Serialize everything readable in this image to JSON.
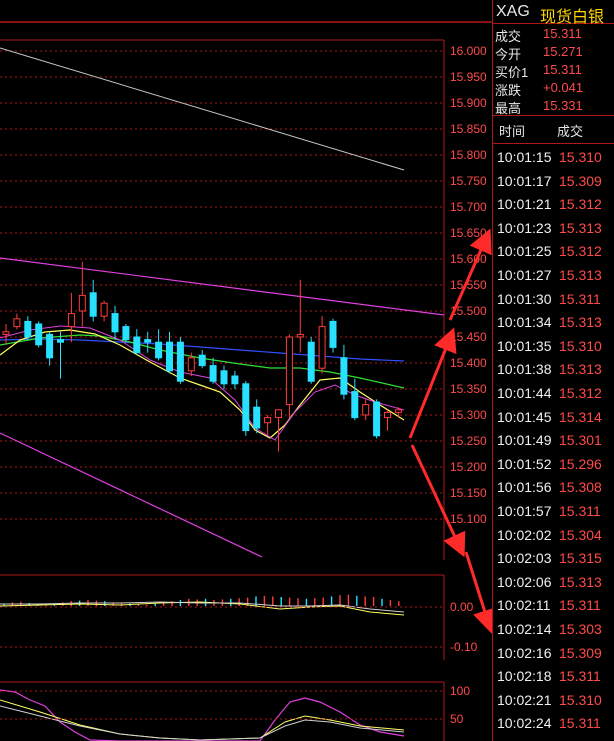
{
  "symbol": "XAG",
  "symbol_name": "现货白银",
  "quote": [
    {
      "label": "成交",
      "value": "15.311"
    },
    {
      "label": "今开",
      "value": "15.271"
    },
    {
      "label": "买价1",
      "value": "15.311"
    },
    {
      "label": "涨跌",
      "value": "+0.041"
    },
    {
      "label": "最高",
      "value": "15.331"
    }
  ],
  "ticks_header": {
    "time": "时间",
    "price": "成交"
  },
  "ticks": [
    {
      "time": "10:01:15",
      "price": "15.310"
    },
    {
      "time": "10:01:17",
      "price": "15.309"
    },
    {
      "time": "10:01:21",
      "price": "15.312"
    },
    {
      "time": "10:01:23",
      "price": "15.313"
    },
    {
      "time": "10:01:25",
      "price": "15.312"
    },
    {
      "time": "10:01:27",
      "price": "15.313"
    },
    {
      "time": "10:01:30",
      "price": "15.311"
    },
    {
      "time": "10:01:34",
      "price": "15.313"
    },
    {
      "time": "10:01:35",
      "price": "15.310"
    },
    {
      "time": "10:01:38",
      "price": "15.313"
    },
    {
      "time": "10:01:44",
      "price": "15.312"
    },
    {
      "time": "10:01:45",
      "price": "15.314"
    },
    {
      "time": "10:01:49",
      "price": "15.301"
    },
    {
      "time": "10:01:52",
      "price": "15.296"
    },
    {
      "time": "10:01:56",
      "price": "15.308"
    },
    {
      "time": "10:01:57",
      "price": "15.311"
    },
    {
      "time": "10:02:02",
      "price": "15.304"
    },
    {
      "time": "10:02:03",
      "price": "15.315"
    },
    {
      "time": "10:02:06",
      "price": "15.313"
    },
    {
      "time": "10:02:11",
      "price": "15.311"
    },
    {
      "time": "10:02:14",
      "price": "15.303"
    },
    {
      "time": "10:02:16",
      "price": "15.309"
    },
    {
      "time": "10:02:18",
      "price": "15.311"
    },
    {
      "time": "10:02:21",
      "price": "15.310"
    },
    {
      "time": "10:02:24",
      "price": "15.311"
    }
  ],
  "colors": {
    "grid": "#b01818",
    "up": "#ff3c3c",
    "down": "#28e0ff",
    "arrow": "#ff2a2a",
    "ma_purple": "#e040e0",
    "ma_yellow": "#ffff60",
    "ma_green": "#30e030",
    "ma_blue": "#3050ff",
    "ma_white": "#d0d0d0"
  },
  "chart_data": [
    {
      "type": "candlestick",
      "y_ticks": [
        "16.000",
        "15.950",
        "15.900",
        "15.850",
        "15.800",
        "15.750",
        "15.700",
        "15.650",
        "15.600",
        "15.550",
        "15.500",
        "15.450",
        "15.400",
        "15.350",
        "15.300",
        "15.250",
        "15.200",
        "15.150",
        "15.100"
      ],
      "ylim": [
        15.09,
        16.01
      ],
      "candles": [
        {
          "o": 15.455,
          "h": 15.475,
          "l": 15.435,
          "c": 15.46
        },
        {
          "o": 15.47,
          "h": 15.495,
          "l": 15.465,
          "c": 15.485
        },
        {
          "o": 15.48,
          "h": 15.49,
          "l": 15.445,
          "c": 15.45
        },
        {
          "o": 15.475,
          "h": 15.48,
          "l": 15.43,
          "c": 15.435
        },
        {
          "o": 15.455,
          "h": 15.46,
          "l": 15.395,
          "c": 15.41
        },
        {
          "o": 15.445,
          "h": 15.46,
          "l": 15.37,
          "c": 15.44
        },
        {
          "o": 15.47,
          "h": 15.535,
          "l": 15.44,
          "c": 15.495
        },
        {
          "o": 15.5,
          "h": 15.595,
          "l": 15.47,
          "c": 15.53
        },
        {
          "o": 15.535,
          "h": 15.56,
          "l": 15.48,
          "c": 15.49
        },
        {
          "o": 15.49,
          "h": 15.52,
          "l": 15.48,
          "c": 15.515
        },
        {
          "o": 15.495,
          "h": 15.51,
          "l": 15.445,
          "c": 15.46
        },
        {
          "o": 15.47,
          "h": 15.475,
          "l": 15.44,
          "c": 15.445
        },
        {
          "o": 15.45,
          "h": 15.465,
          "l": 15.415,
          "c": 15.42
        },
        {
          "o": 15.445,
          "h": 15.46,
          "l": 15.42,
          "c": 15.44
        },
        {
          "o": 15.44,
          "h": 15.465,
          "l": 15.405,
          "c": 15.41
        },
        {
          "o": 15.44,
          "h": 15.46,
          "l": 15.38,
          "c": 15.385
        },
        {
          "o": 15.44,
          "h": 15.45,
          "l": 15.36,
          "c": 15.365
        },
        {
          "o": 15.385,
          "h": 15.42,
          "l": 15.375,
          "c": 15.41
        },
        {
          "o": 15.415,
          "h": 15.425,
          "l": 15.39,
          "c": 15.395
        },
        {
          "o": 15.395,
          "h": 15.41,
          "l": 15.36,
          "c": 15.365
        },
        {
          "o": 15.385,
          "h": 15.395,
          "l": 15.35,
          "c": 15.36
        },
        {
          "o": 15.375,
          "h": 15.385,
          "l": 15.35,
          "c": 15.36
        },
        {
          "o": 15.36,
          "h": 15.365,
          "l": 15.26,
          "c": 15.27
        },
        {
          "o": 15.315,
          "h": 15.33,
          "l": 15.265,
          "c": 15.275
        },
        {
          "o": 15.285,
          "h": 15.3,
          "l": 15.26,
          "c": 15.295
        },
        {
          "o": 15.295,
          "h": 15.31,
          "l": 15.23,
          "c": 15.31
        },
        {
          "o": 15.32,
          "h": 15.455,
          "l": 15.295,
          "c": 15.45
        },
        {
          "o": 15.45,
          "h": 15.56,
          "l": 15.42,
          "c": 15.455
        },
        {
          "o": 15.44,
          "h": 15.45,
          "l": 15.36,
          "c": 15.365
        },
        {
          "o": 15.39,
          "h": 15.49,
          "l": 15.38,
          "c": 15.47
        },
        {
          "o": 15.48,
          "h": 15.485,
          "l": 15.42,
          "c": 15.43
        },
        {
          "o": 15.41,
          "h": 15.435,
          "l": 15.33,
          "c": 15.34
        },
        {
          "o": 15.345,
          "h": 15.37,
          "l": 15.29,
          "c": 15.295
        },
        {
          "o": 15.3,
          "h": 15.33,
          "l": 15.29,
          "c": 15.32
        },
        {
          "o": 15.325,
          "h": 15.33,
          "l": 15.255,
          "c": 15.26
        },
        {
          "o": 15.295,
          "h": 15.31,
          "l": 15.27,
          "c": 15.305
        },
        {
          "o": 15.305,
          "h": 15.315,
          "l": 15.295,
          "c": 15.31
        }
      ]
    },
    {
      "type": "bar",
      "y_ticks": [
        "0.00",
        "-0.10"
      ],
      "values": [
        0.004,
        0.006,
        0.007,
        0.005,
        0.003,
        0.002,
        0.004,
        0.006,
        0.008,
        0.009,
        0.01,
        0.009,
        0.008,
        0.006,
        0.005,
        0.004,
        0.003,
        0.002,
        0.004,
        0.006,
        0.008,
        0.01,
        0.012,
        0.011,
        0.012,
        0.01,
        0.011,
        0.012,
        0.013,
        0.014,
        0.016,
        0.017,
        0.016,
        0.015,
        0.014,
        0.013,
        0.012,
        0.013,
        0.014,
        0.016,
        0.018,
        0.019,
        0.017,
        0.016,
        0.015,
        0.012,
        0.01,
        0.008
      ]
    },
    {
      "type": "line",
      "y_ticks": [
        "100",
        "50"
      ]
    }
  ]
}
